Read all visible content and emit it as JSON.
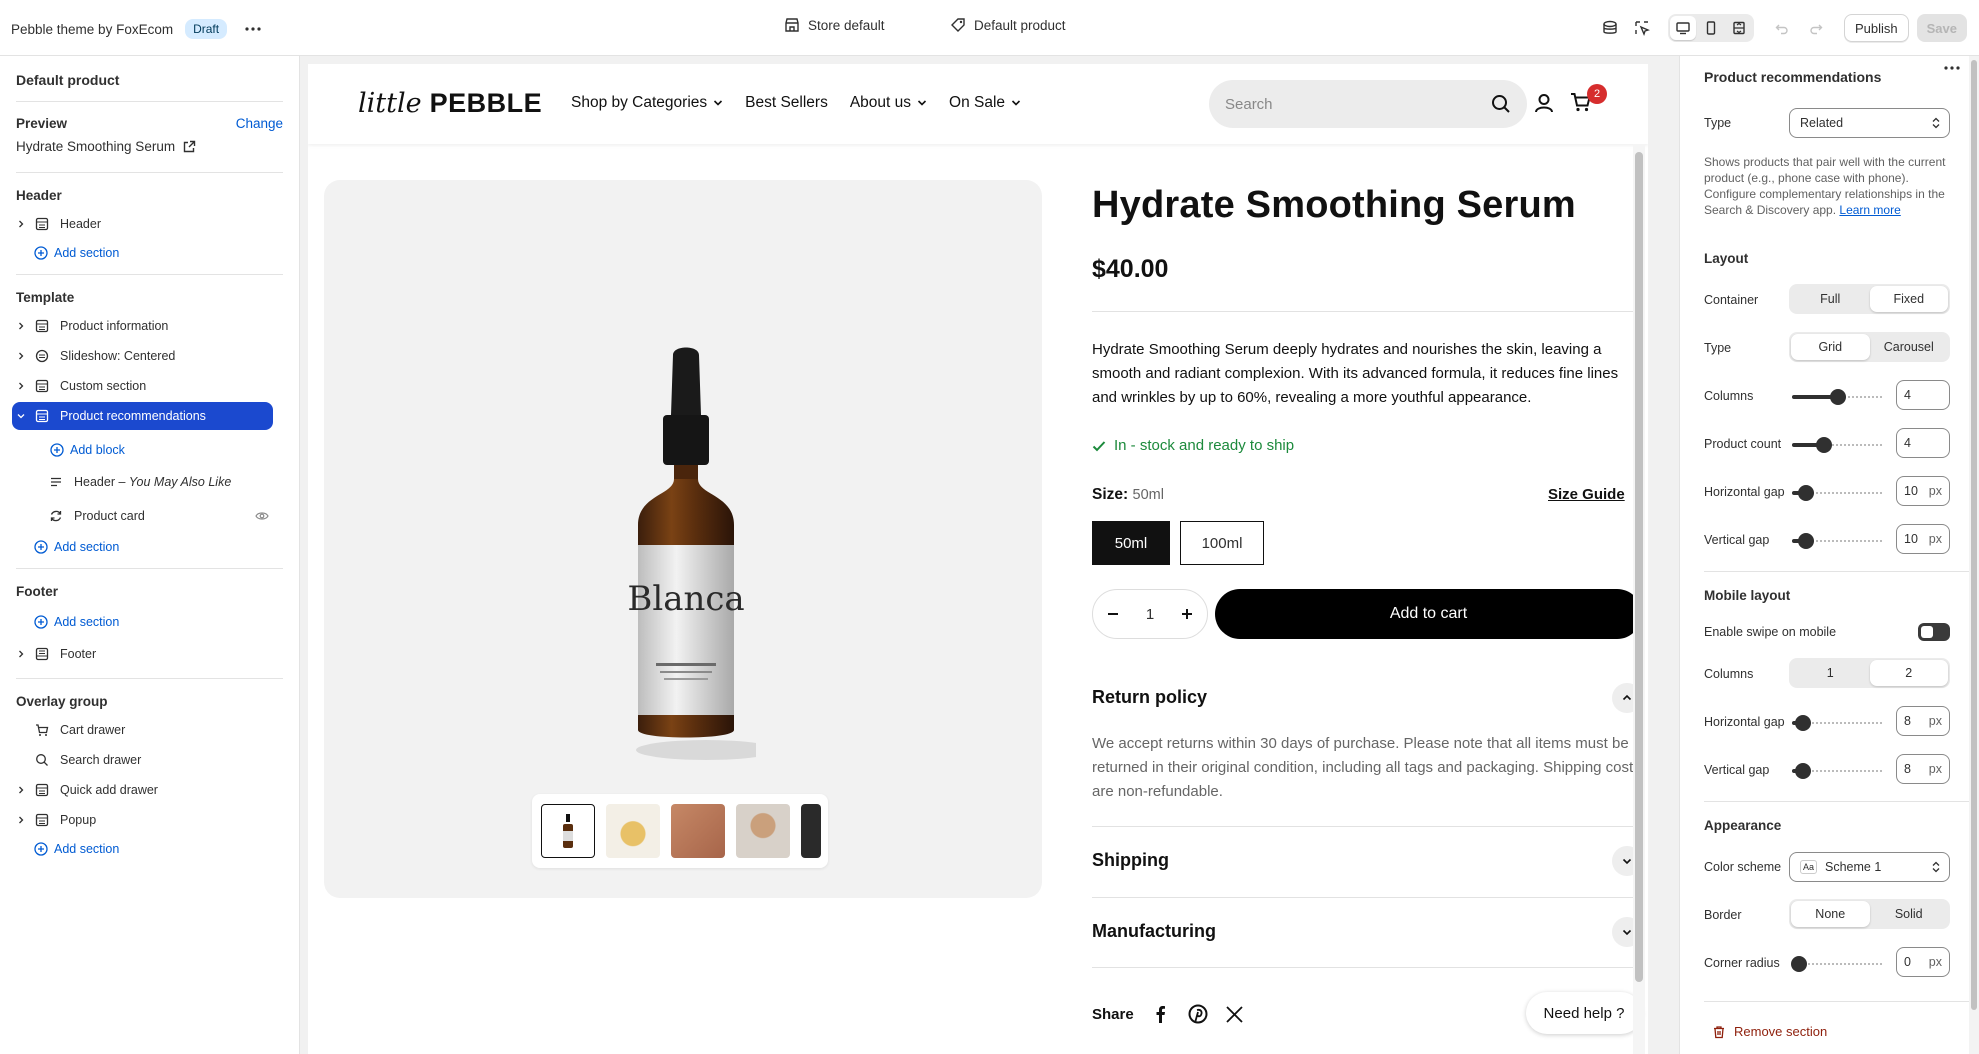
{
  "topbar": {
    "theme_name": "Pebble theme by FoxEcom",
    "status_badge": "Draft",
    "store_selector": "Store default",
    "template_selector": "Default product",
    "publish_label": "Publish",
    "save_label": "Save"
  },
  "sidebar": {
    "title": "Default product",
    "preview_label": "Preview",
    "change_label": "Change",
    "preview_product": "Hydrate Smoothing Serum",
    "header_group": {
      "heading": "Header",
      "items": [
        "Header"
      ],
      "add_section": "Add section"
    },
    "template_group": {
      "heading": "Template",
      "items": [
        "Product information",
        "Slideshow: Centered",
        "Custom section",
        "Product recommendations"
      ],
      "add_block": "Add block",
      "block_header": "Header",
      "block_header_sep": " – ",
      "block_header_sub": "You May Also Like",
      "block_product_card": "Product card",
      "add_section": "Add section"
    },
    "footer_group": {
      "heading": "Footer",
      "add_section": "Add section",
      "items": [
        "Footer"
      ]
    },
    "overlay_group": {
      "heading": "Overlay group",
      "items": [
        "Cart drawer",
        "Search drawer",
        "Quick add drawer",
        "Popup"
      ],
      "add_section": "Add section"
    }
  },
  "store": {
    "logo_script": "little",
    "logo_bold": "PEBBLE",
    "nav": [
      "Shop by Categories",
      "Best Sellers",
      "About us",
      "On Sale"
    ],
    "search_placeholder": "Search",
    "cart_count": "2",
    "bottle_label": "Blanca",
    "product": {
      "title": "Hydrate Smoothing Serum",
      "price": "$40.00",
      "description": "Hydrate Smoothing Serum deeply hydrates and nourishes the skin, leaving a smooth and radiant complexion. With its advanced formula, it reduces fine lines and wrinkles by up to 60%, revealing a more youthful appearance.",
      "stock": "In - stock and ready to ship",
      "size_label": "Size:",
      "size_value": "50ml",
      "size_guide": "Size Guide",
      "sizes": [
        "50ml",
        "100ml"
      ],
      "quantity": "1",
      "add_to_cart": "Add to cart",
      "accordions": [
        "Return policy",
        "Shipping",
        "Manufacturing"
      ],
      "return_policy_text": "We accept returns within 30 days of purchase. Please note that all items must be returned in their original condition, including all tags and packaging. Shipping costs are non-refundable.",
      "share_label": "Share",
      "need_help": "Need help ?"
    }
  },
  "settings": {
    "title": "Product recommendations",
    "type_label": "Type",
    "type_value": "Related",
    "help_text": "Shows products that pair well with the current product (e.g., phone case with phone). Configure complementary relationships in the Search & Discovery app.",
    "learn_more": "Learn more",
    "layout": {
      "heading": "Layout",
      "container_label": "Container",
      "container_options": [
        "Full",
        "Fixed"
      ],
      "type_label": "Type",
      "type_options": [
        "Grid",
        "Carousel"
      ],
      "columns_label": "Columns",
      "columns_value": "4",
      "product_count_label": "Product count",
      "product_count_value": "4",
      "hgap_label": "Horizontal gap",
      "hgap_value": "10",
      "vgap_label": "Vertical gap",
      "vgap_value": "10",
      "unit": "px"
    },
    "mobile": {
      "heading": "Mobile layout",
      "swipe_label": "Enable swipe on mobile",
      "columns_label": "Columns",
      "columns_options": [
        "1",
        "2"
      ],
      "hgap_label": "Horizontal gap",
      "hgap_value": "8",
      "vgap_label": "Vertical gap",
      "vgap_value": "8"
    },
    "appearance": {
      "heading": "Appearance",
      "scheme_label": "Color scheme",
      "scheme_icon": "Aa",
      "scheme_value": "Scheme 1",
      "border_label": "Border",
      "border_options": [
        "None",
        "Solid"
      ],
      "radius_label": "Corner radius",
      "radius_value": "0"
    },
    "remove_label": "Remove section",
    "slider_levels": {
      "columns": 0.5,
      "product_count": 0.35,
      "hgap": 0.15,
      "vgap": 0.15,
      "m_hgap": 0.12,
      "m_vgap": 0.12,
      "radius": 0.08
    }
  },
  "colors": {
    "accent": "#1b49cf",
    "link": "#005bd3",
    "stock": "#1c8a3c",
    "badge": "#d62d2d"
  }
}
